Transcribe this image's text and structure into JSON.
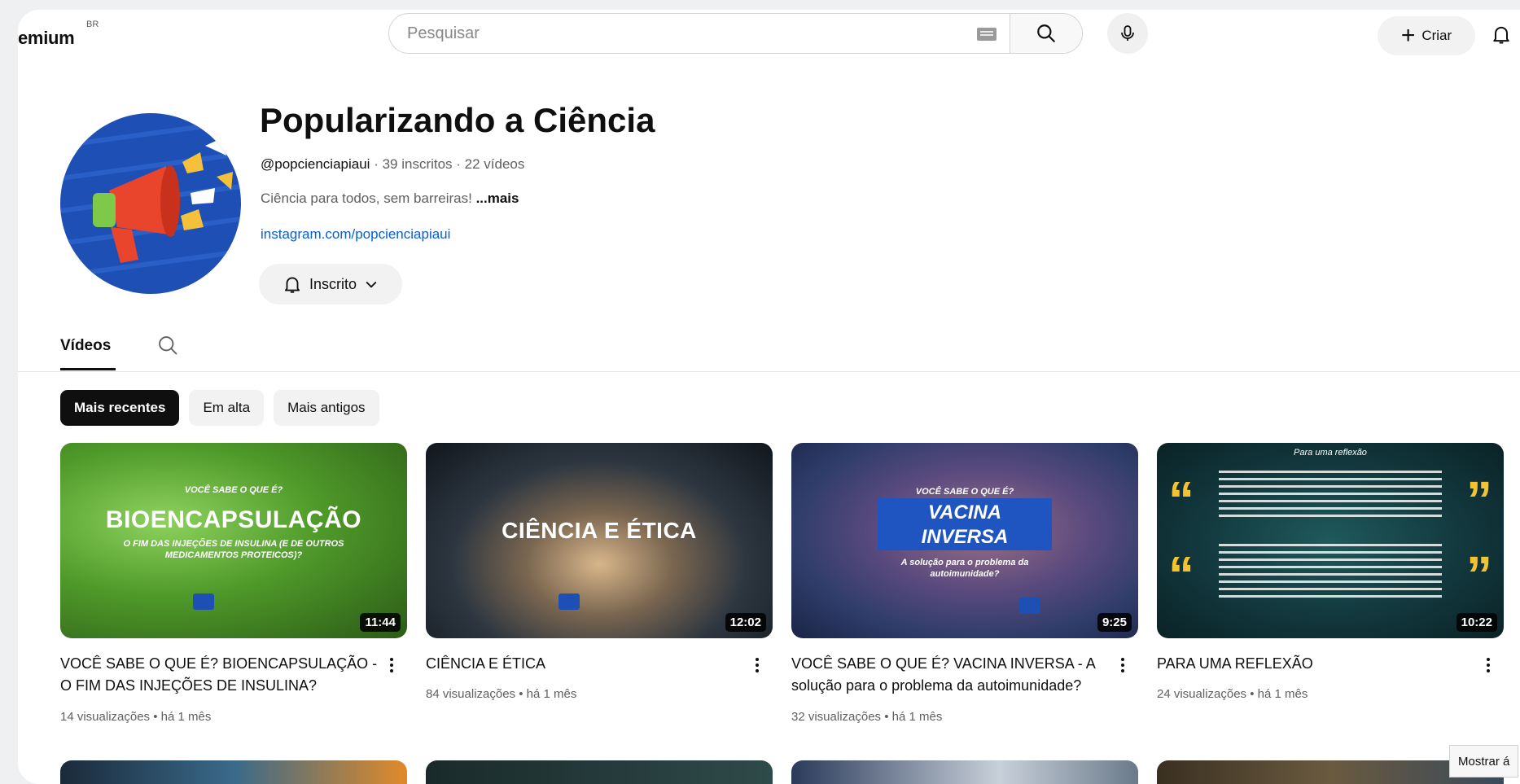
{
  "header": {
    "brand": "emium",
    "brand_country": "BR",
    "search_placeholder": "Pesquisar",
    "create_label": "Criar"
  },
  "channel": {
    "name": "Popularizando a Ciência",
    "handle": "@popcienciapiaui",
    "stats": " · 39 inscritos · 22 vídeos",
    "description": "Ciência para todos, sem barreiras! ",
    "more_label": "...mais",
    "link": "instagram.com/popcienciapiaui",
    "subscribe_label": "Inscrito"
  },
  "tabs": {
    "videos": "Vídeos"
  },
  "chips": [
    "Mais recentes",
    "Em alta",
    "Mais antigos"
  ],
  "videos": [
    {
      "title": "VOCÊ SABE O QUE É? BIOENCAPSULAÇÃO - O FIM DAS INJEÇÕES DE INSULINA?",
      "meta": "14 visualizações • há 1 mês",
      "duration": "11:44",
      "thumb_kicker": "VOCÊ SABE O QUE É?",
      "thumb_title": "BIOENCAPSULAÇÃO",
      "thumb_subtitle": "O FIM DAS INJEÇÕES DE INSULINA (E DE OUTROS MEDICAMENTOS PROTEICOS)?"
    },
    {
      "title": "CIÊNCIA E ÉTICA",
      "meta": "84 visualizações • há 1 mês",
      "duration": "12:02",
      "thumb_title": "CIÊNCIA E ÉTICA"
    },
    {
      "title": "VOCÊ SABE O QUE É? VACINA INVERSA - A solução para o problema da autoimunidade?",
      "meta": "32 visualizações • há 1 mês",
      "duration": "9:25",
      "thumb_kicker": "VOCÊ SABE O QUE É?",
      "thumb_title_1": "VACINA",
      "thumb_title_2": "INVERSA",
      "thumb_subtitle": "A solução para o problema da autoimunidade?"
    },
    {
      "title": "PARA UMA REFLEXÃO",
      "meta": "24 visualizações • há 1 mês",
      "duration": "10:22",
      "thumb_kicker": "Para uma reflexão"
    }
  ],
  "tooltip": "Mostrar á",
  "colors": {
    "link": "#065fd4",
    "text_secondary": "#606060",
    "chip_active": "#0f0f0f"
  }
}
